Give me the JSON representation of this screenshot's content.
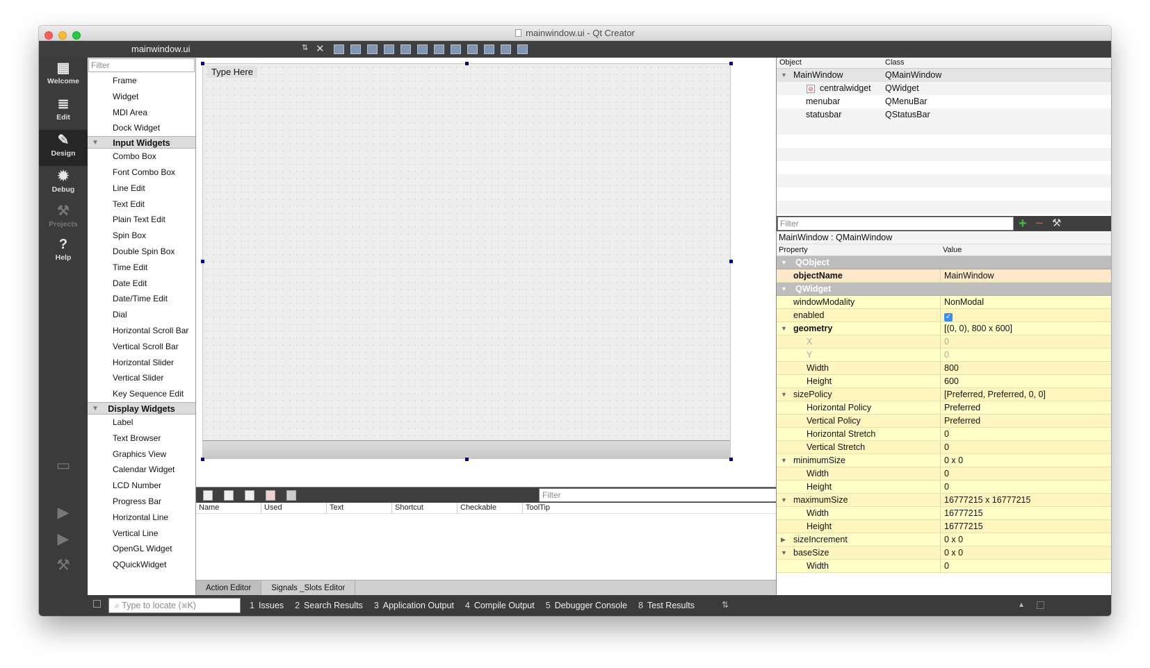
{
  "window": {
    "title": "mainwindow.ui - Qt Creator",
    "file_name": "mainwindow.ui"
  },
  "modes": [
    {
      "label": "Welcome",
      "glyph": "▦"
    },
    {
      "label": "Edit",
      "glyph": "≣"
    },
    {
      "label": "Design",
      "glyph": "✎"
    },
    {
      "label": "Debug",
      "glyph": "✹"
    },
    {
      "label": "Projects",
      "glyph": "⚒"
    },
    {
      "label": "Help",
      "glyph": "?"
    }
  ],
  "widget_box": {
    "filter_placeholder": "Filter",
    "items_top": [
      "Frame",
      "Widget",
      "MDI Area",
      "Dock Widget"
    ],
    "categories": [
      {
        "name": "Input Widgets",
        "items": [
          "Combo Box",
          "Font Combo Box",
          "Line Edit",
          "Text Edit",
          "Plain Text Edit",
          "Spin Box",
          "Double Spin Box",
          "Time Edit",
          "Date Edit",
          "Date/Time Edit",
          "Dial",
          "Horizontal Scroll Bar",
          "Vertical Scroll Bar",
          "Horizontal Slider",
          "Vertical Slider",
          "Key Sequence Edit"
        ]
      },
      {
        "name": "Display Widgets",
        "items": [
          "Label",
          "Text Browser",
          "Graphics View",
          "Calendar Widget",
          "LCD Number",
          "Progress Bar",
          "Horizontal Line",
          "Vertical Line",
          "OpenGL Widget",
          "QQuickWidget"
        ]
      }
    ]
  },
  "form": {
    "menu_placeholder": "Type Here"
  },
  "action_editor": {
    "filter_placeholder": "Filter",
    "columns": [
      "Name",
      "Used",
      "Text",
      "Shortcut",
      "Checkable",
      "ToolTip"
    ],
    "tabs": [
      "Action Editor",
      "Signals _Slots Editor"
    ]
  },
  "object_inspector": {
    "columns": [
      "Object",
      "Class"
    ],
    "rows": [
      {
        "object": "MainWindow",
        "class": "QMainWindow"
      },
      {
        "object": "centralwidget",
        "class": "QWidget"
      },
      {
        "object": "menubar",
        "class": "QMenuBar"
      },
      {
        "object": "statusbar",
        "class": "QStatusBar"
      }
    ]
  },
  "property_editor": {
    "filter_placeholder": "Filter",
    "title": "MainWindow : QMainWindow",
    "columns": [
      "Property",
      "Value"
    ],
    "rows": [
      {
        "name": "QObject",
        "value": "",
        "kind": "group"
      },
      {
        "name": "objectName",
        "value": "MainWindow",
        "kind": "bold"
      },
      {
        "name": "QWidget",
        "value": "",
        "kind": "group"
      },
      {
        "name": "windowModality",
        "value": "NonModal",
        "kind": "normal"
      },
      {
        "name": "enabled",
        "value": "",
        "kind": "check"
      },
      {
        "name": "geometry",
        "value": "[(0, 0), 800 x 600]",
        "kind": "bold-exp"
      },
      {
        "name": "X",
        "value": "0",
        "kind": "sub-dis"
      },
      {
        "name": "Y",
        "value": "0",
        "kind": "sub-dis"
      },
      {
        "name": "Width",
        "value": "800",
        "kind": "sub"
      },
      {
        "name": "Height",
        "value": "600",
        "kind": "sub"
      },
      {
        "name": "sizePolicy",
        "value": "[Preferred, Preferred, 0, 0]",
        "kind": "exp"
      },
      {
        "name": "Horizontal Policy",
        "value": "Preferred",
        "kind": "sub"
      },
      {
        "name": "Vertical Policy",
        "value": "Preferred",
        "kind": "sub"
      },
      {
        "name": "Horizontal Stretch",
        "value": "0",
        "kind": "sub"
      },
      {
        "name": "Vertical Stretch",
        "value": "0",
        "kind": "sub"
      },
      {
        "name": "minimumSize",
        "value": "0 x 0",
        "kind": "exp"
      },
      {
        "name": "Width",
        "value": "0",
        "kind": "sub"
      },
      {
        "name": "Height",
        "value": "0",
        "kind": "sub"
      },
      {
        "name": "maximumSize",
        "value": "16777215 x 16777215",
        "kind": "exp"
      },
      {
        "name": "Width",
        "value": "16777215",
        "kind": "sub"
      },
      {
        "name": "Height",
        "value": "16777215",
        "kind": "sub"
      },
      {
        "name": "sizeIncrement",
        "value": "0 x 0",
        "kind": "col"
      },
      {
        "name": "baseSize",
        "value": "0 x 0",
        "kind": "exp"
      },
      {
        "name": "Width",
        "value": "0",
        "kind": "sub"
      }
    ]
  },
  "bottom_bar": {
    "locate_placeholder": "Type to locate (⌘K)",
    "panes": [
      {
        "num": "1",
        "label": "Issues"
      },
      {
        "num": "2",
        "label": "Search Results"
      },
      {
        "num": "3",
        "label": "Application Output"
      },
      {
        "num": "4",
        "label": "Compile Output"
      },
      {
        "num": "5",
        "label": "Debugger Console"
      },
      {
        "num": "8",
        "label": "Test Results"
      }
    ]
  },
  "colors": {
    "accent_handle": "#0000a0",
    "property_bg": "#fffec6",
    "group_bg": "#bdbdbd",
    "dark_bar": "#3f3f3f"
  }
}
